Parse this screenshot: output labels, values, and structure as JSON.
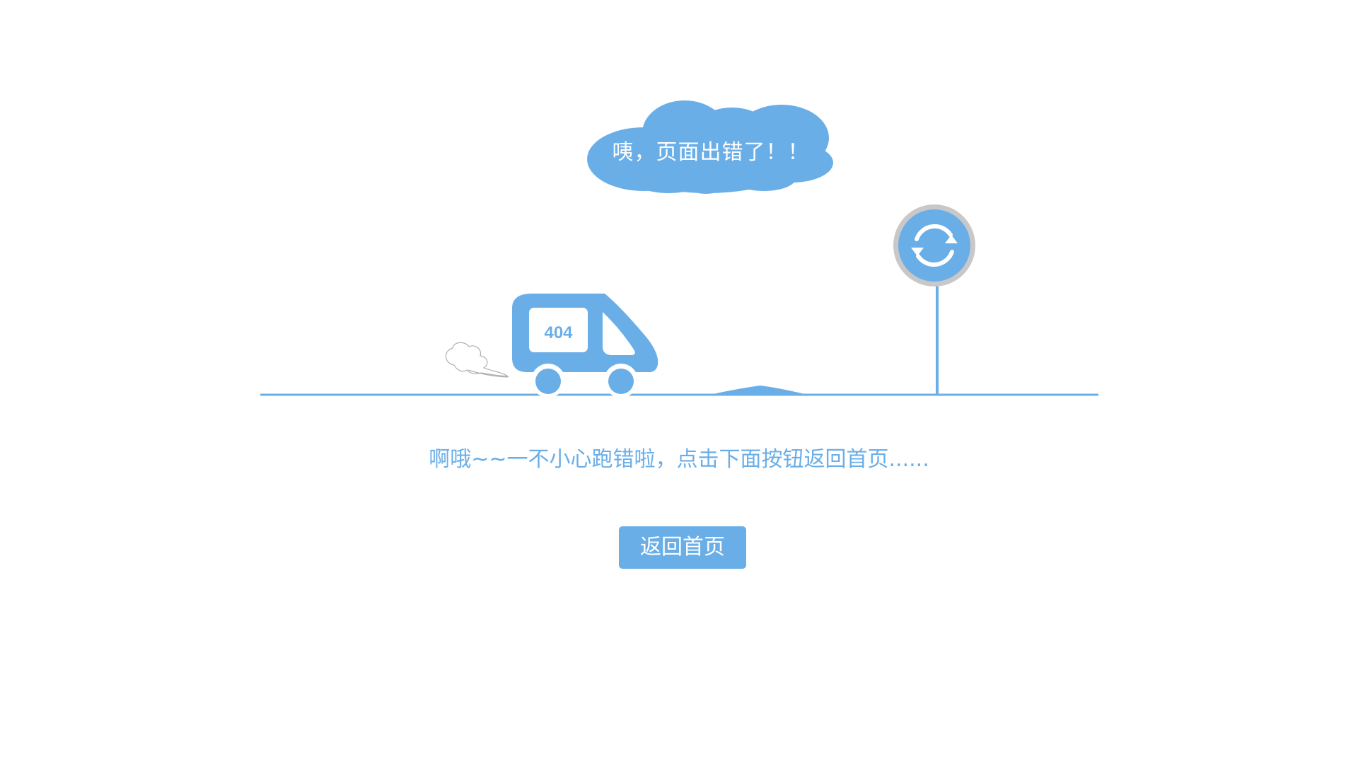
{
  "cloud": {
    "text": "咦，页面出错了！！"
  },
  "van": {
    "plate": "404"
  },
  "main": {
    "message": "啊哦~~一不小心跑错啦，点击下面按钮返回首页......",
    "home_button_label": "返回首页"
  },
  "icons": {
    "sign": "refresh-icon"
  },
  "colors": {
    "accent": "#6aaee8",
    "sign_ring": "#c8c8c8",
    "smoke": "#b0b0b0",
    "background": "#ffffff"
  }
}
